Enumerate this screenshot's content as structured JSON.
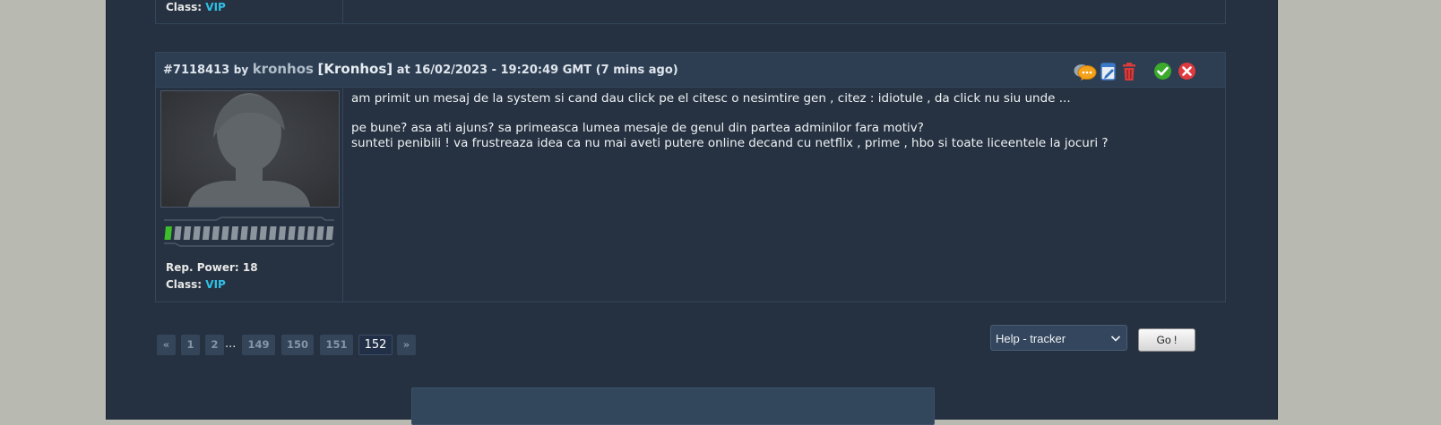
{
  "prev_post": {
    "class_label": "Class:",
    "class_value": "VIP"
  },
  "post": {
    "id": "#7118413",
    "by": "by",
    "username": "kronhos",
    "alias": "[Kronhos]",
    "timestamp": "at 16/02/2023 - 19:20:49 GMT (7 mins ago)",
    "icons": [
      "quote-icon",
      "edit-icon",
      "delete-icon",
      "approve-icon",
      "reject-icon"
    ],
    "rep_power": "Rep. Power: 18",
    "class_label": "Class:",
    "class_value": "VIP",
    "rank_level": 1,
    "rank_segments": 18,
    "message": {
      "line1": "am primit un mesaj de la system si cand dau click pe el  citesc o nesimtire  gen , citez : idiotule , da click nu siu unde ...",
      "line2": "pe bune? asa ati ajuns? sa primeasca lumea  mesaje de genul din  partea adminilor fara motiv?",
      "line3": "sunteti  penibili !  va frustreaza idea ca nu mai aveti putere online decand cu netflix , prime , hbo si toate liceentele la jocuri ?"
    }
  },
  "pagination": {
    "prev": "«",
    "p1": "1",
    "p2": "2",
    "ellipsis": "...",
    "p149": "149",
    "p150": "150",
    "p151": "151",
    "current": "152",
    "next": "»"
  },
  "forum_jump": {
    "selected": "Help - tracker",
    "go_label": "Go !"
  },
  "colors": {
    "accent_vip": "#2fc0e6",
    "background": "#253141",
    "header": "#2d3e52"
  }
}
